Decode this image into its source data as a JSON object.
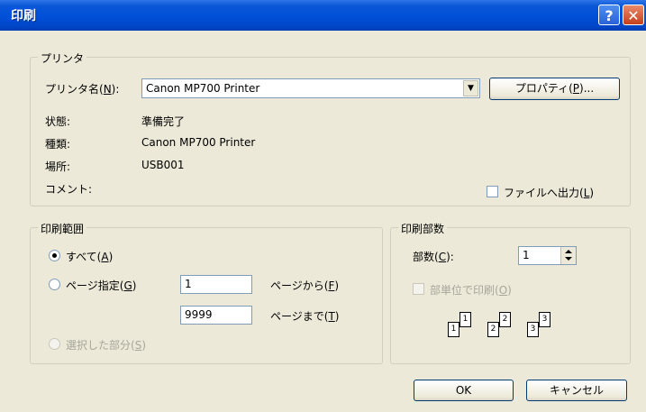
{
  "window": {
    "title": "印刷",
    "help_glyph": "?",
    "close_glyph": "✕"
  },
  "printer": {
    "group_label": "プリンタ",
    "name_label_prefix": "プリンタ名(",
    "name_label_key": "N",
    "name_label_suffix": "):",
    "selected": "Canon MP700 Printer",
    "properties_prefix": "プロパティ(",
    "properties_key": "P",
    "properties_suffix": ")...",
    "status_label": "状態:",
    "status_value": "準備完了",
    "type_label": "種類:",
    "type_value": "Canon MP700 Printer",
    "location_label": "場所:",
    "location_value": "USB001",
    "comment_label": "コメント:",
    "print_to_file_prefix": "ファイルへ出力(",
    "print_to_file_key": "L",
    "print_to_file_suffix": ")"
  },
  "range": {
    "group_label": "印刷範囲",
    "all_prefix": "すべて(",
    "all_key": "A",
    "all_suffix": ")",
    "pages_prefix": "ページ指定(",
    "pages_key": "G",
    "pages_suffix": ")",
    "from_value": "1",
    "from_label_prefix": "ページから(",
    "from_label_key": "F",
    "from_label_suffix": ")",
    "to_value": "9999",
    "to_label_prefix": "ページまで(",
    "to_label_key": "T",
    "to_label_suffix": ")",
    "selection_prefix": "選択した部分(",
    "selection_key": "S",
    "selection_suffix": ")"
  },
  "copies": {
    "group_label": "印刷部数",
    "count_label_prefix": "部数(",
    "count_label_key": "C",
    "count_label_suffix": "):",
    "count_value": "1",
    "collate_prefix": "部単位で印刷(",
    "collate_key": "O",
    "collate_suffix": ")",
    "collate_pages": [
      "1",
      "1",
      "2",
      "2",
      "3",
      "3"
    ]
  },
  "buttons": {
    "ok": "OK",
    "cancel": "キャンセル"
  }
}
